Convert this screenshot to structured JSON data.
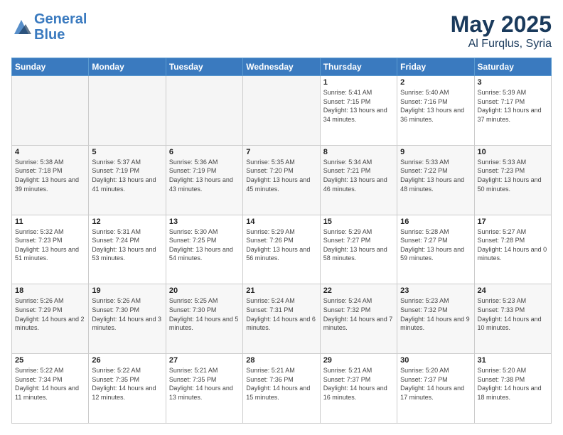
{
  "header": {
    "logo_line1": "General",
    "logo_line2": "Blue",
    "month": "May 2025",
    "location": "Al Furqlus, Syria"
  },
  "weekdays": [
    "Sunday",
    "Monday",
    "Tuesday",
    "Wednesday",
    "Thursday",
    "Friday",
    "Saturday"
  ],
  "weeks": [
    [
      {
        "day": "",
        "empty": true
      },
      {
        "day": "",
        "empty": true
      },
      {
        "day": "",
        "empty": true
      },
      {
        "day": "",
        "empty": true
      },
      {
        "day": "1",
        "sunrise": "5:41 AM",
        "sunset": "7:15 PM",
        "daylight": "13 hours and 34 minutes."
      },
      {
        "day": "2",
        "sunrise": "5:40 AM",
        "sunset": "7:16 PM",
        "daylight": "13 hours and 36 minutes."
      },
      {
        "day": "3",
        "sunrise": "5:39 AM",
        "sunset": "7:17 PM",
        "daylight": "13 hours and 37 minutes."
      }
    ],
    [
      {
        "day": "4",
        "sunrise": "5:38 AM",
        "sunset": "7:18 PM",
        "daylight": "13 hours and 39 minutes."
      },
      {
        "day": "5",
        "sunrise": "5:37 AM",
        "sunset": "7:19 PM",
        "daylight": "13 hours and 41 minutes."
      },
      {
        "day": "6",
        "sunrise": "5:36 AM",
        "sunset": "7:19 PM",
        "daylight": "13 hours and 43 minutes."
      },
      {
        "day": "7",
        "sunrise": "5:35 AM",
        "sunset": "7:20 PM",
        "daylight": "13 hours and 45 minutes."
      },
      {
        "day": "8",
        "sunrise": "5:34 AM",
        "sunset": "7:21 PM",
        "daylight": "13 hours and 46 minutes."
      },
      {
        "day": "9",
        "sunrise": "5:33 AM",
        "sunset": "7:22 PM",
        "daylight": "13 hours and 48 minutes."
      },
      {
        "day": "10",
        "sunrise": "5:33 AM",
        "sunset": "7:23 PM",
        "daylight": "13 hours and 50 minutes."
      }
    ],
    [
      {
        "day": "11",
        "sunrise": "5:32 AM",
        "sunset": "7:23 PM",
        "daylight": "13 hours and 51 minutes."
      },
      {
        "day": "12",
        "sunrise": "5:31 AM",
        "sunset": "7:24 PM",
        "daylight": "13 hours and 53 minutes."
      },
      {
        "day": "13",
        "sunrise": "5:30 AM",
        "sunset": "7:25 PM",
        "daylight": "13 hours and 54 minutes."
      },
      {
        "day": "14",
        "sunrise": "5:29 AM",
        "sunset": "7:26 PM",
        "daylight": "13 hours and 56 minutes."
      },
      {
        "day": "15",
        "sunrise": "5:29 AM",
        "sunset": "7:27 PM",
        "daylight": "13 hours and 58 minutes."
      },
      {
        "day": "16",
        "sunrise": "5:28 AM",
        "sunset": "7:27 PM",
        "daylight": "13 hours and 59 minutes."
      },
      {
        "day": "17",
        "sunrise": "5:27 AM",
        "sunset": "7:28 PM",
        "daylight": "14 hours and 0 minutes."
      }
    ],
    [
      {
        "day": "18",
        "sunrise": "5:26 AM",
        "sunset": "7:29 PM",
        "daylight": "14 hours and 2 minutes."
      },
      {
        "day": "19",
        "sunrise": "5:26 AM",
        "sunset": "7:30 PM",
        "daylight": "14 hours and 3 minutes."
      },
      {
        "day": "20",
        "sunrise": "5:25 AM",
        "sunset": "7:30 PM",
        "daylight": "14 hours and 5 minutes."
      },
      {
        "day": "21",
        "sunrise": "5:24 AM",
        "sunset": "7:31 PM",
        "daylight": "14 hours and 6 minutes."
      },
      {
        "day": "22",
        "sunrise": "5:24 AM",
        "sunset": "7:32 PM",
        "daylight": "14 hours and 7 minutes."
      },
      {
        "day": "23",
        "sunrise": "5:23 AM",
        "sunset": "7:32 PM",
        "daylight": "14 hours and 9 minutes."
      },
      {
        "day": "24",
        "sunrise": "5:23 AM",
        "sunset": "7:33 PM",
        "daylight": "14 hours and 10 minutes."
      }
    ],
    [
      {
        "day": "25",
        "sunrise": "5:22 AM",
        "sunset": "7:34 PM",
        "daylight": "14 hours and 11 minutes."
      },
      {
        "day": "26",
        "sunrise": "5:22 AM",
        "sunset": "7:35 PM",
        "daylight": "14 hours and 12 minutes."
      },
      {
        "day": "27",
        "sunrise": "5:21 AM",
        "sunset": "7:35 PM",
        "daylight": "14 hours and 13 minutes."
      },
      {
        "day": "28",
        "sunrise": "5:21 AM",
        "sunset": "7:36 PM",
        "daylight": "14 hours and 15 minutes."
      },
      {
        "day": "29",
        "sunrise": "5:21 AM",
        "sunset": "7:37 PM",
        "daylight": "14 hours and 16 minutes."
      },
      {
        "day": "30",
        "sunrise": "5:20 AM",
        "sunset": "7:37 PM",
        "daylight": "14 hours and 17 minutes."
      },
      {
        "day": "31",
        "sunrise": "5:20 AM",
        "sunset": "7:38 PM",
        "daylight": "14 hours and 18 minutes."
      }
    ]
  ],
  "labels": {
    "sunrise": "Sunrise:",
    "sunset": "Sunset:",
    "daylight": "Daylight hours"
  }
}
